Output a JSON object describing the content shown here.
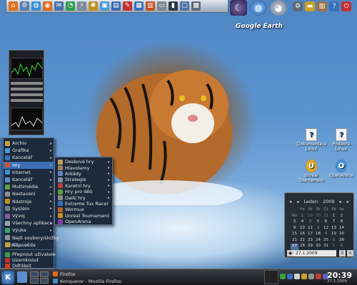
{
  "quick_launch": [
    {
      "icon": "home-icon",
      "color": "#e07020",
      "glyph": "⌂"
    },
    {
      "icon": "gear-icon",
      "color": "#5a7fb0",
      "glyph": "⚙"
    },
    {
      "icon": "globe-icon",
      "color": "#3a8fd0",
      "glyph": "◍"
    },
    {
      "icon": "firefox-icon",
      "color": "#e06a1a",
      "glyph": "◉"
    },
    {
      "icon": "mail-icon",
      "color": "#4a70a8",
      "glyph": "✉"
    },
    {
      "icon": "chat-icon",
      "color": "#2a9a4a",
      "glyph": "◔"
    },
    {
      "icon": "network-icon",
      "color": "#808a9a",
      "glyph": "⚡"
    },
    {
      "icon": "tools-icon",
      "color": "#c09020",
      "glyph": "✱"
    },
    {
      "icon": "image-icon",
      "color": "#4a9ad0",
      "glyph": "▣"
    },
    {
      "icon": "office-icon",
      "color": "#3a6ab0",
      "glyph": "▤"
    },
    {
      "icon": "pen-icon",
      "color": "#c03030",
      "glyph": "✎"
    },
    {
      "icon": "document-icon",
      "color": "#3a70b8",
      "glyph": "▦"
    },
    {
      "icon": "presentation-icon",
      "color": "#c05020",
      "glyph": "▥"
    },
    {
      "icon": "drive-icon",
      "color": "#808890",
      "glyph": "▭"
    },
    {
      "icon": "terminal-icon",
      "color": "#303840",
      "glyph": "▮"
    },
    {
      "icon": "monitor-icon",
      "color": "#5070a0",
      "glyph": "▢"
    },
    {
      "icon": "film-icon",
      "color": "#606a78",
      "glyph": "▩"
    }
  ],
  "google_earth": {
    "label": "Google Earth"
  },
  "start_menu": {
    "items": [
      {
        "label": "Archiv",
        "color": "#c8a040"
      },
      {
        "label": "Grafika",
        "color": "#4a9ad0"
      },
      {
        "label": "Kancelář",
        "color": "#3a70b8"
      },
      {
        "label": "Hry",
        "color": "#d05030"
      },
      {
        "label": "Internet",
        "color": "#3a8fd0"
      },
      {
        "label": "Kancelář",
        "color": "#5a8fc0"
      },
      {
        "label": "Multimédia",
        "color": "#60a040"
      },
      {
        "label": "Nastavení",
        "color": "#909090"
      },
      {
        "label": "Nástroje",
        "color": "#c09020"
      },
      {
        "label": "Systém",
        "color": "#707a88"
      },
      {
        "label": "Vývoj",
        "color": "#8060a0"
      },
      {
        "label": "Všechny aplikace",
        "color": "#a0a0a0"
      },
      {
        "label": "Výuka",
        "color": "#40a070"
      },
      {
        "label": "Najít soubory/složky",
        "color": "#9090a0"
      },
      {
        "label": "Nápověda",
        "color": "#d0a020"
      }
    ],
    "recent_header": "Oblíbené",
    "bottom_items": [
      {
        "label": "Přepnout uživatele",
        "color": "#40a040"
      },
      {
        "label": "Uzamknout",
        "color": "#c03030"
      },
      {
        "label": "Odhlásit",
        "color": "#d04020"
      }
    ]
  },
  "games_submenu": {
    "items": [
      {
        "label": "Deskové hry",
        "color": "#c0a060",
        "arrow": true
      },
      {
        "label": "Hlavolamy",
        "color": "#a08060",
        "arrow": true
      },
      {
        "label": "Arkády",
        "color": "#6080c0",
        "arrow": true
      },
      {
        "label": "Strategie",
        "color": "#8090a0",
        "arrow": true
      },
      {
        "label": "Karetní hry",
        "color": "#c04040",
        "arrow": true
      },
      {
        "label": "Hry pro děti",
        "color": "#60a040",
        "arrow": true
      },
      {
        "label": "Další hry",
        "color": "#8a8a8a",
        "arrow": true
      },
      {
        "label": "Extreme Tux Racer",
        "color": "#3070c0",
        "arrow": false
      },
      {
        "label": "Wormux",
        "color": "#c06020",
        "arrow": false
      },
      {
        "label": "Unreal Tournament",
        "color": "#c09020",
        "arrow": false
      },
      {
        "label": "OpenArena",
        "color": "#8040a0",
        "arrow": false
      }
    ]
  },
  "desktop_icons": [
    {
      "label": "Dokumentace Linux",
      "glyph": "?",
      "style": "doc"
    },
    {
      "label": "Podpora Linux",
      "glyph": "?",
      "style": "doc"
    },
    {
      "label": "Unreal Tournament",
      "glyph": "U",
      "style": "round"
    },
    {
      "label": "OpenArena",
      "glyph": "O",
      "style": "blue"
    }
  ],
  "calendar": {
    "month": "Leden",
    "year": "2009",
    "weekdays": [
      "",
      "Po",
      "Út",
      "St",
      "Čt",
      "Pá",
      "So",
      "Ne"
    ],
    "weeks": [
      [
        "1",
        "29",
        "30",
        "31",
        "1",
        "2",
        "3",
        "4"
      ],
      [
        "2",
        "5",
        "6",
        "7",
        "8",
        "9",
        "10",
        "11"
      ],
      [
        "3",
        "12",
        "13",
        "14",
        "15",
        "16",
        "17",
        "18"
      ],
      [
        "4",
        "19",
        "20",
        "21",
        "22",
        "23",
        "24",
        "25"
      ],
      [
        "5",
        "26",
        "27",
        "28",
        "29",
        "30",
        "31",
        "1"
      ],
      [
        "6",
        "2",
        "3",
        "4",
        "5",
        "6",
        "7",
        "8"
      ]
    ],
    "selected_date": "27.1.2009",
    "today": "27"
  },
  "taskbar": {
    "kde_label": "K",
    "tasks": [
      {
        "label": "Firefox",
        "color": "#e06a1a"
      },
      {
        "label": "Konqueror - Mozilla Firefox",
        "color": "#3a8fd0"
      }
    ],
    "clock": "20:39",
    "date": "27.1.2009"
  }
}
